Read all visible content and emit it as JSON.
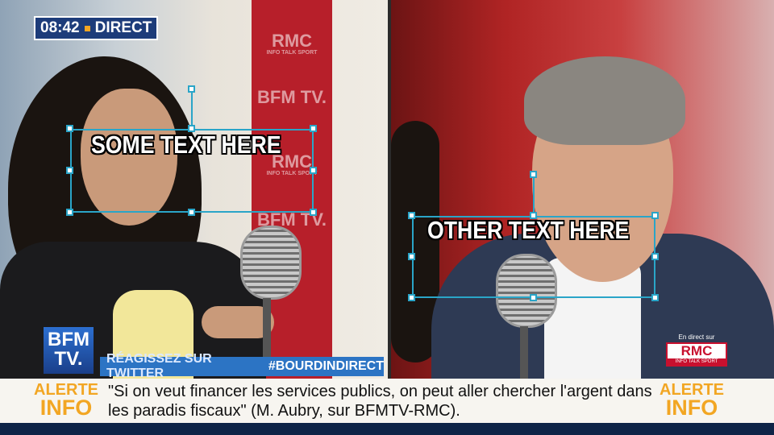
{
  "live_badge": {
    "time": "08:42",
    "label": "DIRECT"
  },
  "text_boxes": [
    {
      "text": "SOME TEXT HERE"
    },
    {
      "text": "OTHER TEXT HERE"
    }
  ],
  "studio_wall": {
    "brand_1": "RMC",
    "brand_1_tag": "INFO TALK SPORT",
    "brand_2": "BFM TV."
  },
  "channel_logo": {
    "text": "BFM TV."
  },
  "twitter_bar": {
    "prompt": "RÉAGISSEZ SUR TWITTER",
    "hashtag": "#BOURDINDIRECT"
  },
  "ticker": {
    "alert_top": "ALERTE",
    "alert_bottom": "INFO",
    "quote": "\"Si on veut financer les services publics, on peut aller chercher l'argent dans les paradis fiscaux\" (M. Aubry, sur BFMTV-RMC)."
  },
  "rmc_badge": {
    "label": "En direct sur",
    "logo": "RMC",
    "tagline": "INFO TALK SPORT"
  },
  "colors": {
    "selection": "#2aa5c8",
    "alert": "#f2a623",
    "bfm_blue": "#2c74c4",
    "rmc_red": "#c8102e"
  }
}
